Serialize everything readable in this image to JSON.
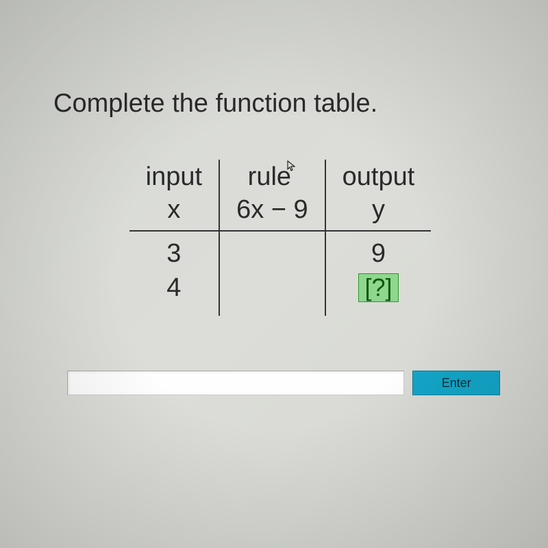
{
  "instruction": "Complete the function table.",
  "table": {
    "headers": {
      "col1_top": "input",
      "col1_sub": "x",
      "col2_top": "rule",
      "col2_sub": "6x − 9",
      "col3_top": "output",
      "col3_sub": "y"
    },
    "rows": [
      {
        "input": "3",
        "rule": "",
        "output": "9"
      },
      {
        "input": "4",
        "rule": "",
        "output": "[?]"
      }
    ]
  },
  "answer_input": {
    "value": "",
    "placeholder": ""
  },
  "buttons": {
    "enter": "Enter"
  }
}
